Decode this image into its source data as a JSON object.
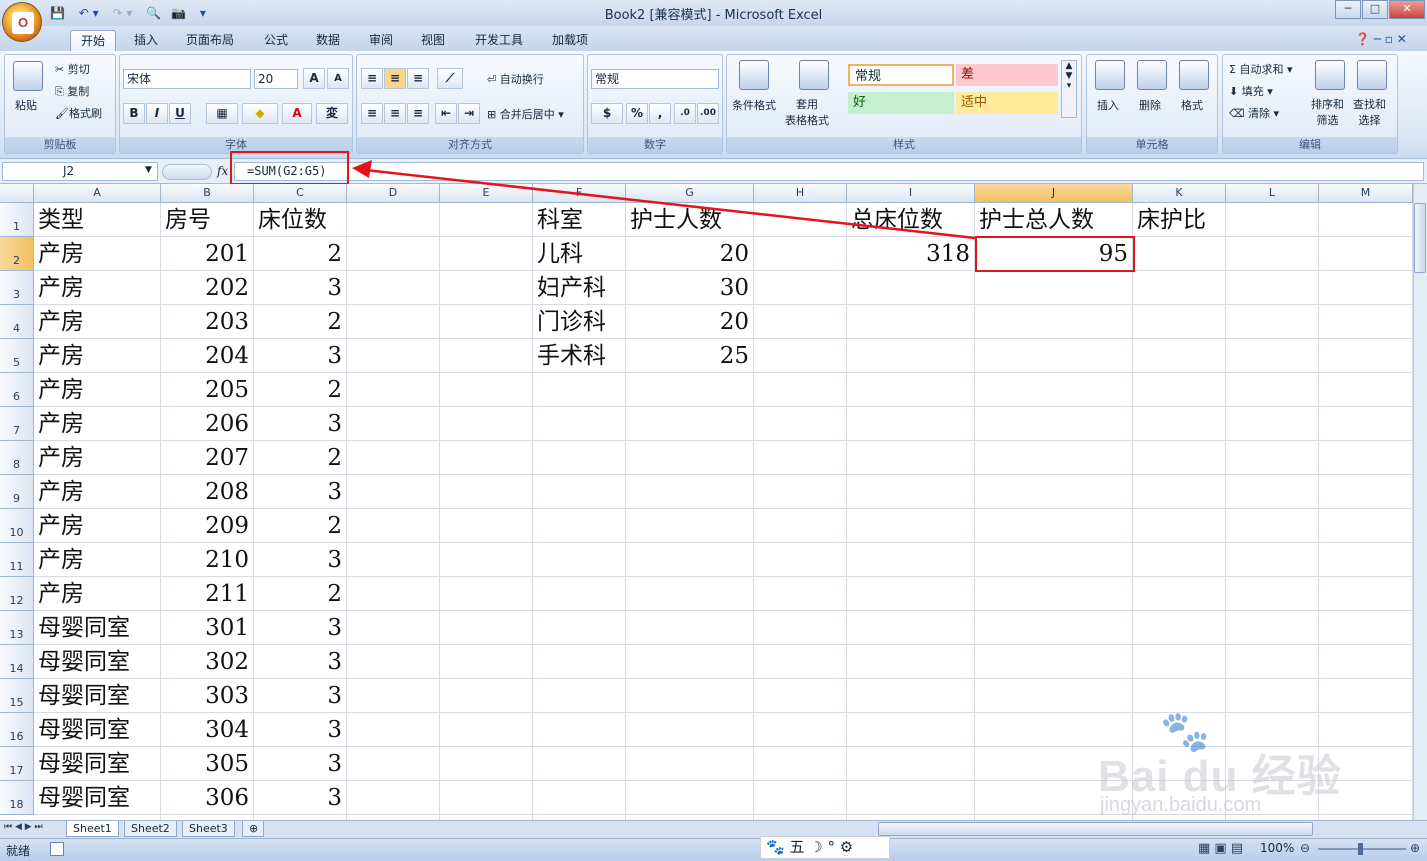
{
  "window": {
    "title": "Book2  [兼容模式] - Microsoft Excel",
    "min": "─",
    "max": "□",
    "close": "✕"
  },
  "qat": {
    "items": [
      "💾",
      "↶ ▾",
      "↷ ▾",
      "🔍",
      "📷",
      "▾"
    ]
  },
  "tabs": [
    "开始",
    "插入",
    "页面布局",
    "公式",
    "数据",
    "审阅",
    "视图",
    "开发工具",
    "加载项"
  ],
  "ribbon": {
    "clipboard": {
      "label": "剪贴板",
      "paste": "粘贴",
      "cut": "剪切",
      "copy": "复制",
      "format_painter": "格式刷"
    },
    "font": {
      "label": "字体",
      "font_name": "宋体",
      "font_size": "20",
      "bold": "B",
      "italic": "I",
      "underline": "U"
    },
    "alignment": {
      "label": "对齐方式",
      "wrap": "自动换行",
      "merge": "合并后居中"
    },
    "number": {
      "label": "数字",
      "format": "常规",
      "percent": "%",
      "comma": ","
    },
    "styles": {
      "label": "样式",
      "cond_format": "条件格式",
      "table_format": "套用\n表格格式",
      "normal": "常规",
      "bad": "差",
      "good": "好",
      "neutral": "适中"
    },
    "cells": {
      "label": "单元格",
      "insert": "插入",
      "delete": "删除",
      "format": "格式"
    },
    "editing": {
      "label": "编辑",
      "autosum": "自动求和",
      "fill": "填充",
      "clear": "清除",
      "sort": "排序和\n筛选",
      "find": "查找和\n选择"
    }
  },
  "formula_bar": {
    "name_box": "J2",
    "fx": "fx",
    "formula": "=SUM(G2:G5)"
  },
  "columns": [
    "A",
    "B",
    "C",
    "D",
    "E",
    "F",
    "G",
    "H",
    "I",
    "J",
    "K",
    "L",
    "M"
  ],
  "rows": [
    "1",
    "2",
    "3",
    "4",
    "5",
    "6",
    "7",
    "8",
    "9",
    "10",
    "11",
    "12",
    "13",
    "14",
    "15",
    "16",
    "17",
    "18"
  ],
  "table_left": {
    "headers": [
      "类型",
      "房号",
      "床位数"
    ],
    "rows": [
      [
        "产房",
        "201",
        "2"
      ],
      [
        "产房",
        "202",
        "3"
      ],
      [
        "产房",
        "203",
        "2"
      ],
      [
        "产房",
        "204",
        "3"
      ],
      [
        "产房",
        "205",
        "2"
      ],
      [
        "产房",
        "206",
        "3"
      ],
      [
        "产房",
        "207",
        "2"
      ],
      [
        "产房",
        "208",
        "3"
      ],
      [
        "产房",
        "209",
        "2"
      ],
      [
        "产房",
        "210",
        "3"
      ],
      [
        "产房",
        "211",
        "2"
      ],
      [
        "母婴同室",
        "301",
        "3"
      ],
      [
        "母婴同室",
        "302",
        "3"
      ],
      [
        "母婴同室",
        "303",
        "3"
      ],
      [
        "母婴同室",
        "304",
        "3"
      ],
      [
        "母婴同室",
        "305",
        "3"
      ],
      [
        "母婴同室",
        "306",
        "3"
      ]
    ]
  },
  "table_mid": {
    "headers": [
      "科室",
      "护士人数"
    ],
    "rows": [
      [
        "儿科",
        "20"
      ],
      [
        "妇产科",
        "30"
      ],
      [
        "门诊科",
        "20"
      ],
      [
        "手术科",
        "25"
      ]
    ]
  },
  "summary": {
    "headers": [
      "总床位数",
      "护士总人数",
      "床护比"
    ],
    "values": [
      "318",
      "95",
      ""
    ]
  },
  "sheets": [
    "Sheet1",
    "Sheet2",
    "Sheet3"
  ],
  "status": {
    "ready": "就绪",
    "zoom": "100%",
    "ime": [
      "🐾",
      "五",
      "☽",
      "°",
      "⚙"
    ]
  },
  "watermark": {
    "brand": "Bai du 经验",
    "url": "jingyan.baidu.com"
  },
  "colors": {
    "accent_red": "#e2161a",
    "header_sel": "#f1c15f",
    "ribbon_bg": "#dbe7f5"
  }
}
